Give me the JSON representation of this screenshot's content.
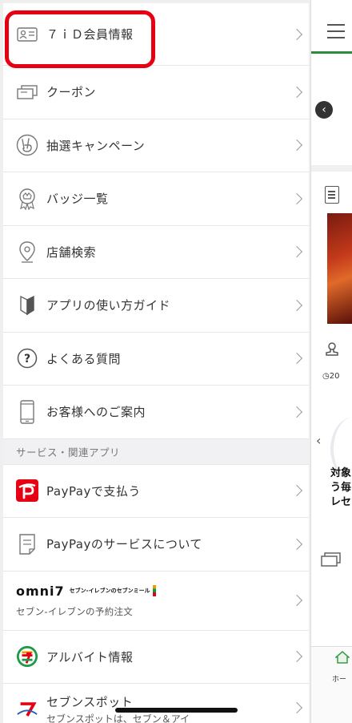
{
  "menu": {
    "items": [
      {
        "label": "７ｉＤ会員情報",
        "icon": "id-card-icon"
      },
      {
        "label": "クーポン",
        "icon": "coupon-icon"
      },
      {
        "label": "抽選キャンペーン",
        "icon": "peace-hand-icon"
      },
      {
        "label": "バッジ一覧",
        "icon": "badge-icon"
      },
      {
        "label": "店舗検索",
        "icon": "location-pin-icon"
      },
      {
        "label": "アプリの使い方ガイド",
        "icon": "beginner-mark-icon"
      },
      {
        "label": "よくある質問",
        "icon": "question-icon"
      },
      {
        "label": "お客様へのご案内",
        "icon": "smartphone-icon"
      }
    ]
  },
  "section": {
    "title": "サービス・関連アプリ",
    "items": [
      {
        "label": "PayPayで支払う",
        "icon": "paypay-icon"
      },
      {
        "label": "PayPayのサービスについて",
        "icon": "document-icon"
      },
      {
        "brand": "omni7",
        "brand_small": "セブン-イレブンのセブンミール",
        "label": "セブン-イレブンの予約注文",
        "icon": "omni7-logo"
      },
      {
        "label": "アルバイト情報",
        "icon": "seven-eleven-logo"
      },
      {
        "label": "セブンスポット",
        "sub": "セブンスポットは、セブン＆アイ",
        "icon": "seven-spot-icon"
      }
    ]
  },
  "background": {
    "time": "20",
    "teaser": [
      "対象",
      "う毎",
      "レセ"
    ],
    "home_label": "ホー"
  },
  "colors": {
    "highlight": "#e60012",
    "paypay": "#e60012",
    "accent_green": "#2e8b3e"
  }
}
